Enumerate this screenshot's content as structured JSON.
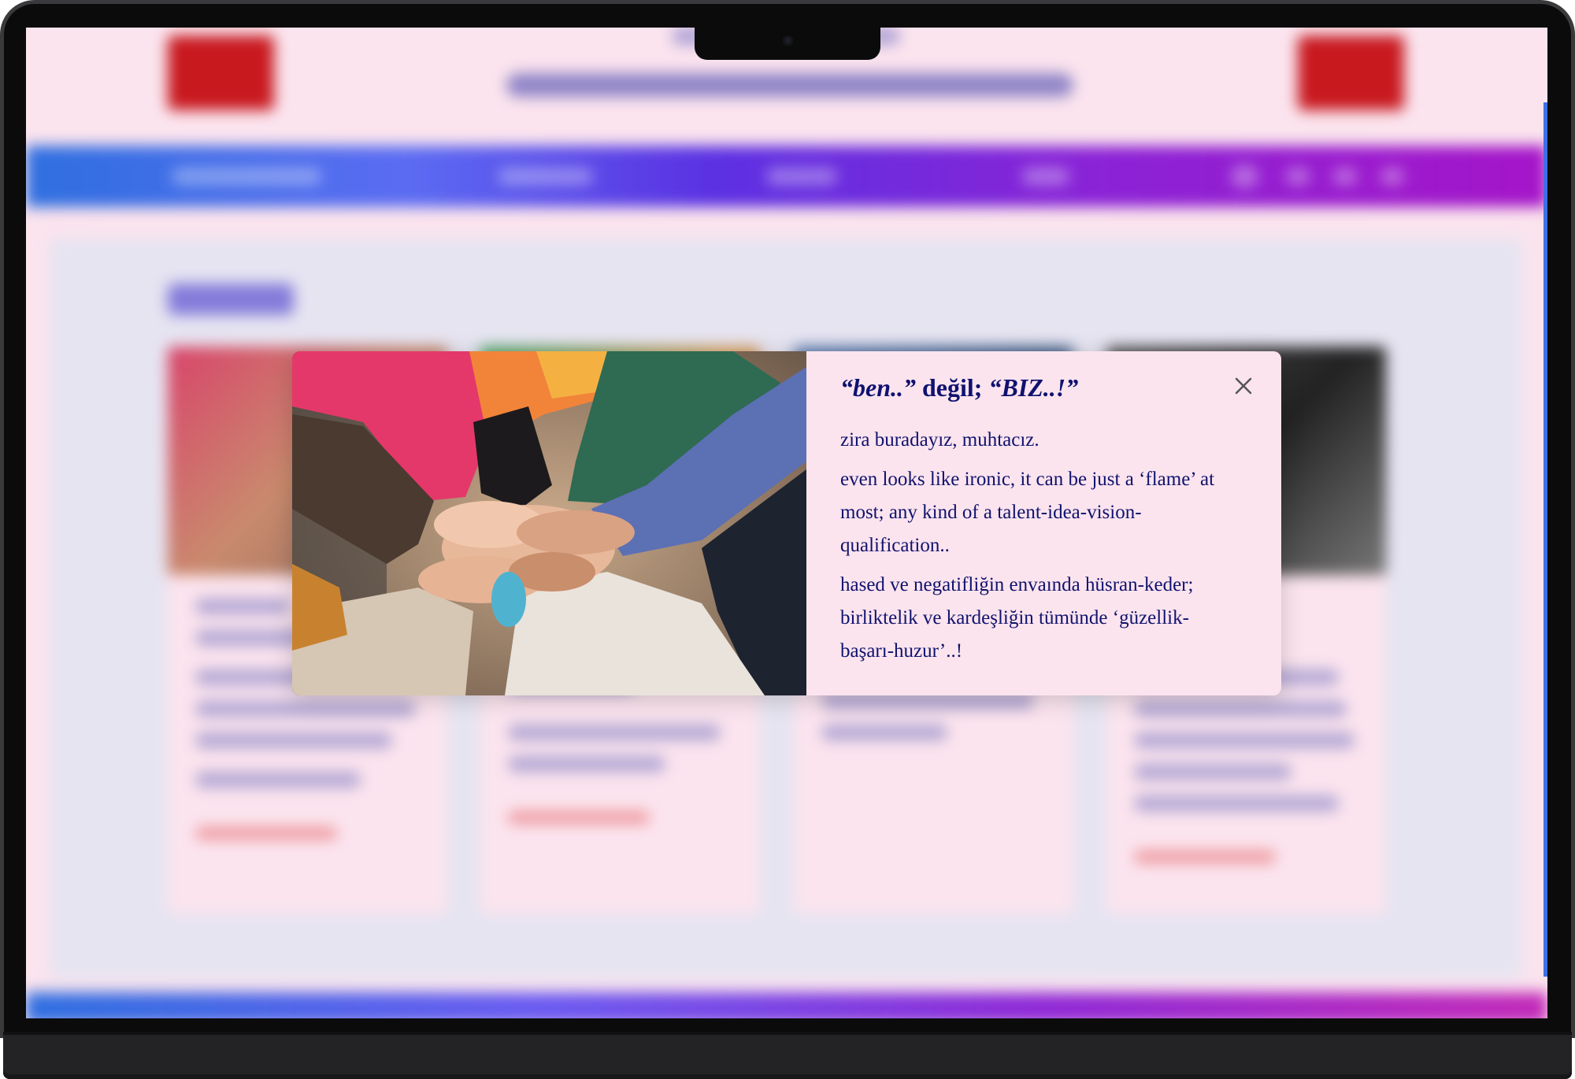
{
  "modal": {
    "title_part1": "“ben..” ",
    "title_part2": "değil; ",
    "title_part3": "“BIZ..!”",
    "paragraph1": "zira buradayız, muhtacız.",
    "paragraph2": "even looks like ironic, it can be just a ‘flame’ at most; any kind of a talent-idea-vision-qualification..",
    "paragraph3": "hased ve negatifliğin envaında hüsran-keder; birliktelik ve kardeşliğin tümünde ‘güzellik-başarı-huzur’..!",
    "close_icon": "close-icon"
  },
  "colors": {
    "modal_bg": "#fbe4ee",
    "text": "#10126e",
    "nav_gradient_start": "#2f6fe0",
    "nav_gradient_end": "#a515c8",
    "logo_red": "#c8191f"
  }
}
